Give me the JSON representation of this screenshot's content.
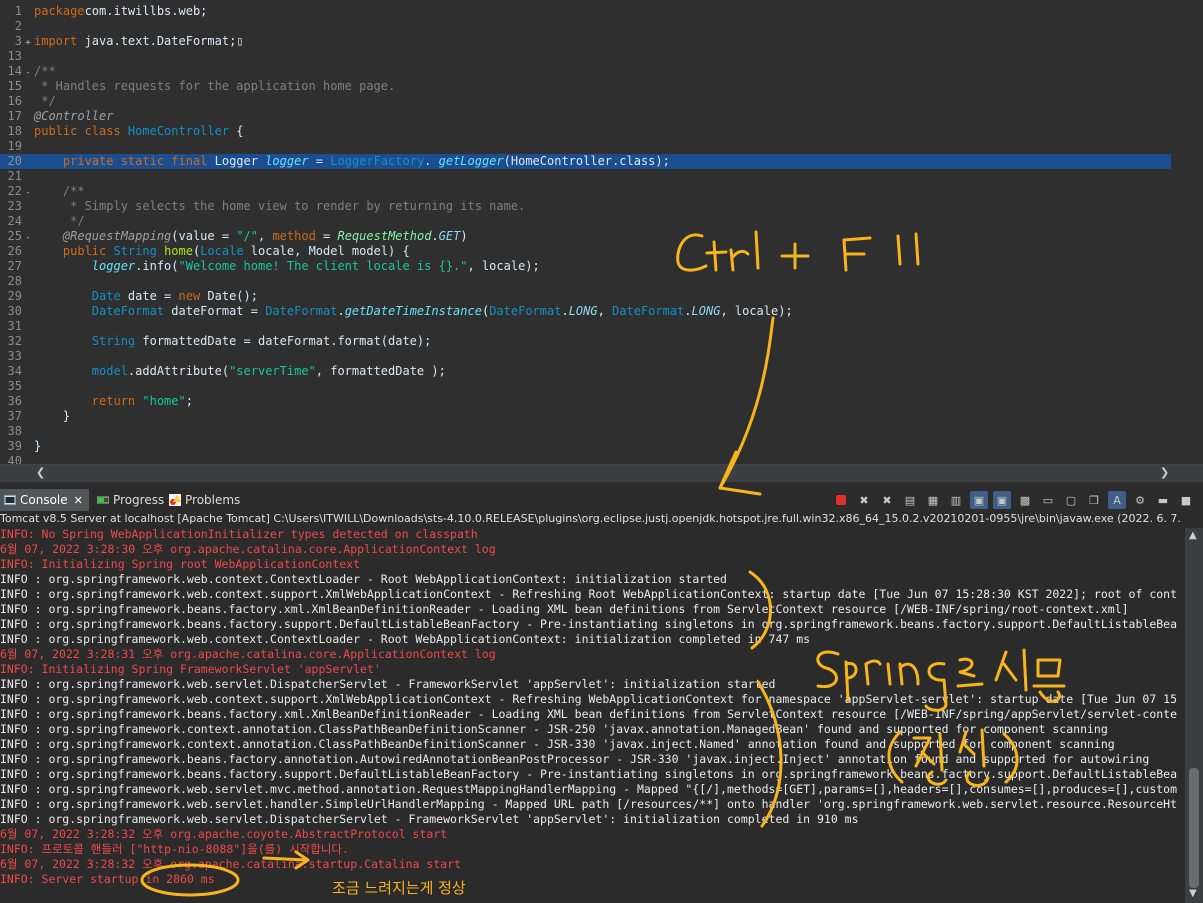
{
  "editor": {
    "lines": [
      {
        "n": "1",
        "fold": "",
        "hl": "",
        "segs": [
          [
            "kw",
            "package"
          ],
          [
            "",
            "com.itwillbs.web;"
          ]
        ]
      },
      {
        "n": "2",
        "fold": "",
        "hl": "",
        "segs": []
      },
      {
        "n": "3",
        "fold": "+",
        "hl": "",
        "segs": [
          [
            "kw",
            "import"
          ],
          [
            "",
            " java.text.DateFormat;"
          ],
          [
            "",
            "▯"
          ]
        ]
      },
      {
        "n": "13",
        "fold": "",
        "hl": "",
        "segs": []
      },
      {
        "n": "14",
        "fold": "-",
        "hl": "",
        "segs": [
          [
            "cm",
            "/**"
          ]
        ]
      },
      {
        "n": "15",
        "fold": "",
        "hl": "",
        "segs": [
          [
            "cm",
            " * Handles requests for the application home page."
          ]
        ]
      },
      {
        "n": "16",
        "fold": "",
        "hl": "",
        "segs": [
          [
            "cm",
            " */"
          ]
        ]
      },
      {
        "n": "17",
        "fold": "",
        "hl": "",
        "segs": [
          [
            "an",
            "@Controller"
          ]
        ]
      },
      {
        "n": "18",
        "fold": "",
        "hl": "",
        "segs": [
          [
            "kw",
            "public class "
          ],
          [
            "ty",
            "HomeController"
          ],
          [
            "",
            " {"
          ]
        ]
      },
      {
        "n": "19",
        "fold": "",
        "hl": "",
        "segs": []
      },
      {
        "n": "20",
        "fold": "",
        "hl": "hl",
        "segs": [
          [
            "",
            "    "
          ],
          [
            "kw",
            "private static final "
          ],
          [
            "",
            "Logger "
          ],
          [
            "fi",
            "logger"
          ],
          [
            "",
            " = "
          ],
          [
            "ty",
            "LoggerFactory"
          ],
          [
            "",
            ". "
          ],
          [
            "fi",
            "getLogger"
          ],
          [
            "",
            "(HomeController.class);"
          ]
        ]
      },
      {
        "n": "21",
        "fold": "",
        "hl": "hl-blank",
        "segs": [
          [
            "",
            ""
          ]
        ]
      },
      {
        "n": "22",
        "fold": "-",
        "hl": "",
        "segs": [
          [
            "cm",
            "    /**"
          ]
        ]
      },
      {
        "n": "23",
        "fold": "",
        "hl": "",
        "segs": [
          [
            "cm",
            "     * Simply selects the home view to render by returning its name."
          ]
        ]
      },
      {
        "n": "24",
        "fold": "",
        "hl": "",
        "segs": [
          [
            "cm",
            "     */"
          ]
        ]
      },
      {
        "n": "25",
        "fold": "-",
        "hl": "",
        "segs": [
          [
            "",
            "    "
          ],
          [
            "an",
            "@RequestMapping"
          ],
          [
            "",
            "(value = "
          ],
          [
            "st",
            "\"/\""
          ],
          [
            "",
            ", "
          ],
          [
            "kw",
            "method"
          ],
          [
            "",
            " = "
          ],
          [
            "sm",
            "RequestMethod"
          ],
          [
            "",
            "."
          ],
          [
            "en",
            "GET"
          ],
          [
            "",
            ")"
          ]
        ]
      },
      {
        "n": "26",
        "fold": "",
        "hl": "",
        "segs": [
          [
            "",
            "    "
          ],
          [
            "kw",
            "public "
          ],
          [
            "ty",
            "String "
          ],
          [
            "fn",
            "home"
          ],
          [
            "",
            "("
          ],
          [
            "ty",
            "Locale "
          ],
          [
            "",
            "locale, Model model) {"
          ]
        ]
      },
      {
        "n": "27",
        "fold": "",
        "hl": "",
        "segs": [
          [
            "",
            "        "
          ],
          [
            "fi",
            "logger"
          ],
          [
            "",
            ".info("
          ],
          [
            "st",
            "\"Welcome home! The client locale is {}.\""
          ],
          [
            "",
            ", locale);"
          ]
        ]
      },
      {
        "n": "28",
        "fold": "",
        "hl": "",
        "segs": []
      },
      {
        "n": "29",
        "fold": "",
        "hl": "",
        "segs": [
          [
            "",
            "        "
          ],
          [
            "ty",
            "Date "
          ],
          [
            "",
            "date = "
          ],
          [
            "kw",
            "new "
          ],
          [
            "",
            "Date();"
          ]
        ]
      },
      {
        "n": "30",
        "fold": "",
        "hl": "",
        "segs": [
          [
            "",
            "        "
          ],
          [
            "ty",
            "DateFormat "
          ],
          [
            "",
            "dateFormat = "
          ],
          [
            "ty",
            "DateFormat"
          ],
          [
            "",
            "."
          ],
          [
            "fi",
            "getDateTimeInstance"
          ],
          [
            "",
            "("
          ],
          [
            "ty",
            "DateFormat"
          ],
          [
            "",
            "."
          ],
          [
            "en",
            "LONG"
          ],
          [
            "",
            ", "
          ],
          [
            "ty",
            "DateFormat"
          ],
          [
            "",
            "."
          ],
          [
            "en",
            "LONG"
          ],
          [
            "",
            ", locale);"
          ]
        ]
      },
      {
        "n": "31",
        "fold": "",
        "hl": "",
        "segs": []
      },
      {
        "n": "32",
        "fold": "",
        "hl": "",
        "segs": [
          [
            "",
            "        "
          ],
          [
            "ty",
            "String "
          ],
          [
            "",
            "formattedDate = dateFormat.format(date);"
          ]
        ]
      },
      {
        "n": "33",
        "fold": "",
        "hl": "",
        "segs": []
      },
      {
        "n": "34",
        "fold": "",
        "hl": "",
        "segs": [
          [
            "",
            "        "
          ],
          [
            "ty",
            "model"
          ],
          [
            "",
            ".addAttribute("
          ],
          [
            "st",
            "\"serverTime\""
          ],
          [
            "",
            ", formattedDate );"
          ]
        ]
      },
      {
        "n": "35",
        "fold": "",
        "hl": "",
        "segs": []
      },
      {
        "n": "36",
        "fold": "",
        "hl": "",
        "segs": [
          [
            "",
            "        "
          ],
          [
            "kw",
            "return "
          ],
          [
            "st",
            "\"home\""
          ],
          [
            "",
            ";"
          ]
        ]
      },
      {
        "n": "37",
        "fold": "",
        "hl": "",
        "segs": [
          [
            "",
            "    }"
          ]
        ]
      },
      {
        "n": "38",
        "fold": "",
        "hl": "",
        "segs": []
      },
      {
        "n": "39",
        "fold": "",
        "hl": "",
        "segs": [
          [
            "",
            "}"
          ]
        ]
      },
      {
        "n": "40",
        "fold": "",
        "hl": "",
        "segs": []
      }
    ]
  },
  "tabs": {
    "console": "Console",
    "progress": "Progress",
    "problems": "Problems"
  },
  "console": {
    "header": "Tomcat v8.5 Server at localhost [Apache Tomcat] C:\\Users\\ITWILL\\Downloads\\sts-4.10.0.RELEASE\\plugins\\org.eclipse.justj.openjdk.hotspot.jre.full.win32.x86_64_15.0.2.v20210201-0955\\jre\\bin\\javaw.exe  (2022. 6. 7.",
    "lines": [
      {
        "k": "err",
        "t": "INFO: No Spring WebApplicationInitializer types detected on classpath"
      },
      {
        "k": "err",
        "t": "6월 07, 2022 3:28:30 오후 org.apache.catalina.core.ApplicationContext log"
      },
      {
        "k": "err",
        "t": "INFO: Initializing Spring root WebApplicationContext"
      },
      {
        "k": "info",
        "t": "INFO : org.springframework.web.context.ContextLoader - Root WebApplicationContext: initialization started"
      },
      {
        "k": "info",
        "t": "INFO : org.springframework.web.context.support.XmlWebApplicationContext - Refreshing Root WebApplicationContext: startup date [Tue Jun 07 15:28:30 KST 2022]; root of cont"
      },
      {
        "k": "info",
        "t": "INFO : org.springframework.beans.factory.xml.XmlBeanDefinitionReader - Loading XML bean definitions from ServletContext resource [/WEB-INF/spring/root-context.xml]"
      },
      {
        "k": "info",
        "t": "INFO : org.springframework.beans.factory.support.DefaultListableBeanFactory - Pre-instantiating singletons in org.springframework.beans.factory.support.DefaultListableBea"
      },
      {
        "k": "info",
        "t": "INFO : org.springframework.web.context.ContextLoader - Root WebApplicationContext: initialization completed in 747 ms"
      },
      {
        "k": "err",
        "t": "6월 07, 2022 3:28:31 오후 org.apache.catalina.core.ApplicationContext log"
      },
      {
        "k": "err",
        "t": "INFO: Initializing Spring FrameworkServlet 'appServlet'"
      },
      {
        "k": "info",
        "t": "INFO : org.springframework.web.servlet.DispatcherServlet - FrameworkServlet 'appServlet': initialization started"
      },
      {
        "k": "info",
        "t": "INFO : org.springframework.web.context.support.XmlWebApplicationContext - Refreshing WebApplicationContext for namespace 'appServlet-servlet': startup date [Tue Jun 07 15"
      },
      {
        "k": "info",
        "t": "INFO : org.springframework.beans.factory.xml.XmlBeanDefinitionReader - Loading XML bean definitions from ServletContext resource [/WEB-INF/spring/appServlet/servlet-conte"
      },
      {
        "k": "info",
        "t": "INFO : org.springframework.context.annotation.ClassPathBeanDefinitionScanner - JSR-250 'javax.annotation.ManagedBean' found and supported for component scanning"
      },
      {
        "k": "info",
        "t": "INFO : org.springframework.context.annotation.ClassPathBeanDefinitionScanner - JSR-330 'javax.inject.Named' annotation found and supported for component scanning"
      },
      {
        "k": "info",
        "t": "INFO : org.springframework.beans.factory.annotation.AutowiredAnnotationBeanPostProcessor - JSR-330 'javax.inject.Inject' annotation found and supported for autowiring"
      },
      {
        "k": "info",
        "t": "INFO : org.springframework.beans.factory.support.DefaultListableBeanFactory - Pre-instantiating singletons in org.springframework.beans.factory.support.DefaultListableBea"
      },
      {
        "k": "info",
        "t": "INFO : org.springframework.web.servlet.mvc.method.annotation.RequestMappingHandlerMapping - Mapped \"{[/],methods=[GET],params=[],headers=[],consumes=[],produces=[],custom"
      },
      {
        "k": "info",
        "t": "INFO : org.springframework.web.servlet.handler.SimpleUrlHandlerMapping - Mapped URL path [/resources/**] onto handler 'org.springframework.web.servlet.resource.ResourceHt"
      },
      {
        "k": "info",
        "t": "INFO : org.springframework.web.servlet.DispatcherServlet - FrameworkServlet 'appServlet': initialization completed in 910 ms"
      },
      {
        "k": "err",
        "t": "6월 07, 2022 3:28:32 오후 org.apache.coyote.AbstractProtocol start"
      },
      {
        "k": "err",
        "t": "INFO: 프로토콜 핸들러 [\"http-nio-8088\"]을(를) 시작합니다."
      },
      {
        "k": "err",
        "t": "6월 07, 2022 3:28:32 오후 org.apache.catalina.startup.Catalina start"
      },
      {
        "k": "err",
        "t": "INFO: Server startup in 2860 ms"
      }
    ]
  },
  "annotations": {
    "note": "조금 느려지는게 정상"
  },
  "colors": {
    "annotation": "#f7b41d",
    "console_error": "#ee4a4a",
    "selection": "#1b4d8f"
  }
}
